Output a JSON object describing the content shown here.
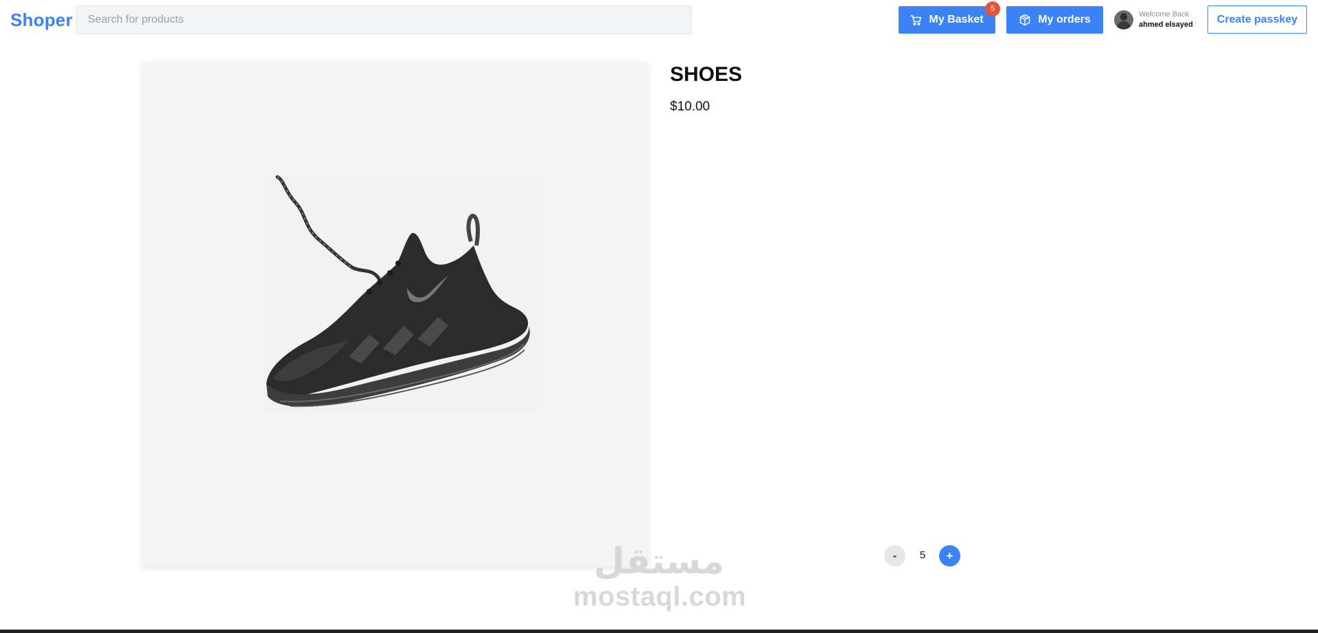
{
  "header": {
    "logo": "Shoper",
    "search": {
      "placeholder": "Search for products",
      "value": ""
    },
    "basket": {
      "label": "My Basket",
      "badge_count": "5",
      "icon": "shopping-cart-icon"
    },
    "orders": {
      "label": "My orders",
      "icon": "package-box-icon"
    },
    "user": {
      "welcome": "Welcome Back",
      "name": "ahmed elsayed"
    },
    "passkey_label": "Create passkey"
  },
  "product": {
    "title": "SHOES",
    "price": "$10.00",
    "image_alt": "black running shoe"
  },
  "quantity": {
    "minus_label": "-",
    "value": "5",
    "plus_label": "+"
  },
  "watermark": {
    "arabic": "مستقل",
    "latin": "mostaql.com"
  },
  "colors": {
    "accent": "#3b82f6",
    "badge": "#e5533c",
    "page_background": "#ffffff"
  }
}
